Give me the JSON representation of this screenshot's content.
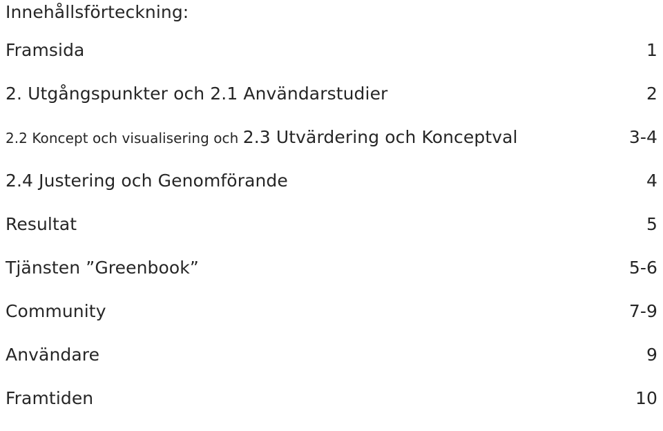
{
  "document": {
    "title": "Innehållsförteckning:",
    "language": "sv",
    "text_color": "#262626",
    "background_color": "#ffffff"
  },
  "toc": {
    "entries": [
      {
        "label": "Framsida",
        "label_small_prefix": "",
        "label_main": "Framsida",
        "page": "1"
      },
      {
        "label": "2. Utgångspunkter och 2.1 Användarstudier",
        "label_small_prefix": "",
        "label_main": "2. Utgångspunkter och 2.1 Användarstudier",
        "page": "2"
      },
      {
        "label": "2.2 Koncept och visualisering och 2.3 Utvärdering och Konceptval",
        "label_small_prefix": "2.2 Koncept och visualisering och ",
        "label_main": "2.3 Utvärdering och Konceptval",
        "page": "3-4"
      },
      {
        "label": "2.4 Justering och Genomförande",
        "label_small_prefix": "",
        "label_main": "2.4 Justering och Genomförande",
        "page": "4"
      },
      {
        "label": "Resultat",
        "label_small_prefix": "",
        "label_main": "Resultat",
        "page": "5"
      },
      {
        "label": "Tjänsten ”Greenbook”",
        "label_small_prefix": "",
        "label_main": "Tjänsten ”Greenbook”",
        "page": "5-6"
      },
      {
        "label": "Community",
        "label_small_prefix": "",
        "label_main": "Community",
        "page": "7-9"
      },
      {
        "label": "Användare",
        "label_small_prefix": "",
        "label_main": "Användare",
        "page": "9"
      },
      {
        "label": "Framtiden",
        "label_small_prefix": "",
        "label_main": "Framtiden",
        "page": "10"
      }
    ]
  }
}
